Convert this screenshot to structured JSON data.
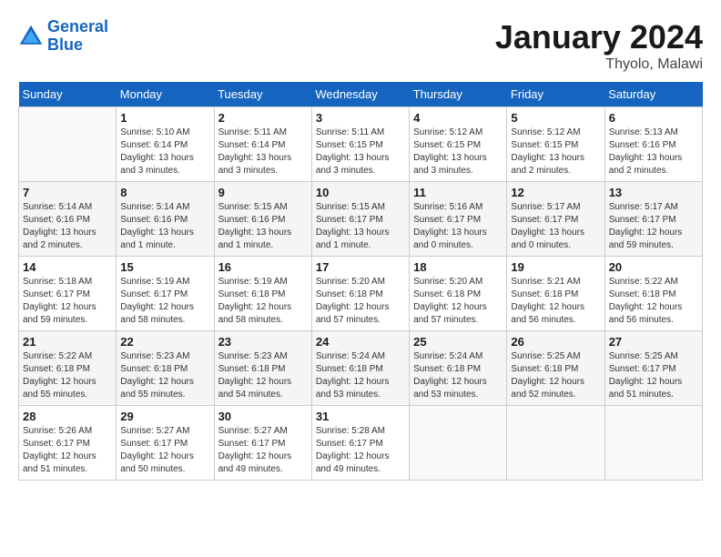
{
  "header": {
    "logo_line1": "General",
    "logo_line2": "Blue",
    "month_title": "January 2024",
    "subtitle": "Thyolo, Malawi"
  },
  "weekdays": [
    "Sunday",
    "Monday",
    "Tuesday",
    "Wednesday",
    "Thursday",
    "Friday",
    "Saturday"
  ],
  "weeks": [
    [
      {
        "day": "",
        "sunrise": "",
        "sunset": "",
        "daylight": ""
      },
      {
        "day": "1",
        "sunrise": "Sunrise: 5:10 AM",
        "sunset": "Sunset: 6:14 PM",
        "daylight": "Daylight: 13 hours and 3 minutes."
      },
      {
        "day": "2",
        "sunrise": "Sunrise: 5:11 AM",
        "sunset": "Sunset: 6:14 PM",
        "daylight": "Daylight: 13 hours and 3 minutes."
      },
      {
        "day": "3",
        "sunrise": "Sunrise: 5:11 AM",
        "sunset": "Sunset: 6:15 PM",
        "daylight": "Daylight: 13 hours and 3 minutes."
      },
      {
        "day": "4",
        "sunrise": "Sunrise: 5:12 AM",
        "sunset": "Sunset: 6:15 PM",
        "daylight": "Daylight: 13 hours and 3 minutes."
      },
      {
        "day": "5",
        "sunrise": "Sunrise: 5:12 AM",
        "sunset": "Sunset: 6:15 PM",
        "daylight": "Daylight: 13 hours and 2 minutes."
      },
      {
        "day": "6",
        "sunrise": "Sunrise: 5:13 AM",
        "sunset": "Sunset: 6:16 PM",
        "daylight": "Daylight: 13 hours and 2 minutes."
      }
    ],
    [
      {
        "day": "7",
        "sunrise": "Sunrise: 5:14 AM",
        "sunset": "Sunset: 6:16 PM",
        "daylight": "Daylight: 13 hours and 2 minutes."
      },
      {
        "day": "8",
        "sunrise": "Sunrise: 5:14 AM",
        "sunset": "Sunset: 6:16 PM",
        "daylight": "Daylight: 13 hours and 1 minute."
      },
      {
        "day": "9",
        "sunrise": "Sunrise: 5:15 AM",
        "sunset": "Sunset: 6:16 PM",
        "daylight": "Daylight: 13 hours and 1 minute."
      },
      {
        "day": "10",
        "sunrise": "Sunrise: 5:15 AM",
        "sunset": "Sunset: 6:17 PM",
        "daylight": "Daylight: 13 hours and 1 minute."
      },
      {
        "day": "11",
        "sunrise": "Sunrise: 5:16 AM",
        "sunset": "Sunset: 6:17 PM",
        "daylight": "Daylight: 13 hours and 0 minutes."
      },
      {
        "day": "12",
        "sunrise": "Sunrise: 5:17 AM",
        "sunset": "Sunset: 6:17 PM",
        "daylight": "Daylight: 13 hours and 0 minutes."
      },
      {
        "day": "13",
        "sunrise": "Sunrise: 5:17 AM",
        "sunset": "Sunset: 6:17 PM",
        "daylight": "Daylight: 12 hours and 59 minutes."
      }
    ],
    [
      {
        "day": "14",
        "sunrise": "Sunrise: 5:18 AM",
        "sunset": "Sunset: 6:17 PM",
        "daylight": "Daylight: 12 hours and 59 minutes."
      },
      {
        "day": "15",
        "sunrise": "Sunrise: 5:19 AM",
        "sunset": "Sunset: 6:17 PM",
        "daylight": "Daylight: 12 hours and 58 minutes."
      },
      {
        "day": "16",
        "sunrise": "Sunrise: 5:19 AM",
        "sunset": "Sunset: 6:18 PM",
        "daylight": "Daylight: 12 hours and 58 minutes."
      },
      {
        "day": "17",
        "sunrise": "Sunrise: 5:20 AM",
        "sunset": "Sunset: 6:18 PM",
        "daylight": "Daylight: 12 hours and 57 minutes."
      },
      {
        "day": "18",
        "sunrise": "Sunrise: 5:20 AM",
        "sunset": "Sunset: 6:18 PM",
        "daylight": "Daylight: 12 hours and 57 minutes."
      },
      {
        "day": "19",
        "sunrise": "Sunrise: 5:21 AM",
        "sunset": "Sunset: 6:18 PM",
        "daylight": "Daylight: 12 hours and 56 minutes."
      },
      {
        "day": "20",
        "sunrise": "Sunrise: 5:22 AM",
        "sunset": "Sunset: 6:18 PM",
        "daylight": "Daylight: 12 hours and 56 minutes."
      }
    ],
    [
      {
        "day": "21",
        "sunrise": "Sunrise: 5:22 AM",
        "sunset": "Sunset: 6:18 PM",
        "daylight": "Daylight: 12 hours and 55 minutes."
      },
      {
        "day": "22",
        "sunrise": "Sunrise: 5:23 AM",
        "sunset": "Sunset: 6:18 PM",
        "daylight": "Daylight: 12 hours and 55 minutes."
      },
      {
        "day": "23",
        "sunrise": "Sunrise: 5:23 AM",
        "sunset": "Sunset: 6:18 PM",
        "daylight": "Daylight: 12 hours and 54 minutes."
      },
      {
        "day": "24",
        "sunrise": "Sunrise: 5:24 AM",
        "sunset": "Sunset: 6:18 PM",
        "daylight": "Daylight: 12 hours and 53 minutes."
      },
      {
        "day": "25",
        "sunrise": "Sunrise: 5:24 AM",
        "sunset": "Sunset: 6:18 PM",
        "daylight": "Daylight: 12 hours and 53 minutes."
      },
      {
        "day": "26",
        "sunrise": "Sunrise: 5:25 AM",
        "sunset": "Sunset: 6:18 PM",
        "daylight": "Daylight: 12 hours and 52 minutes."
      },
      {
        "day": "27",
        "sunrise": "Sunrise: 5:25 AM",
        "sunset": "Sunset: 6:17 PM",
        "daylight": "Daylight: 12 hours and 51 minutes."
      }
    ],
    [
      {
        "day": "28",
        "sunrise": "Sunrise: 5:26 AM",
        "sunset": "Sunset: 6:17 PM",
        "daylight": "Daylight: 12 hours and 51 minutes."
      },
      {
        "day": "29",
        "sunrise": "Sunrise: 5:27 AM",
        "sunset": "Sunset: 6:17 PM",
        "daylight": "Daylight: 12 hours and 50 minutes."
      },
      {
        "day": "30",
        "sunrise": "Sunrise: 5:27 AM",
        "sunset": "Sunset: 6:17 PM",
        "daylight": "Daylight: 12 hours and 49 minutes."
      },
      {
        "day": "31",
        "sunrise": "Sunrise: 5:28 AM",
        "sunset": "Sunset: 6:17 PM",
        "daylight": "Daylight: 12 hours and 49 minutes."
      },
      {
        "day": "",
        "sunrise": "",
        "sunset": "",
        "daylight": ""
      },
      {
        "day": "",
        "sunrise": "",
        "sunset": "",
        "daylight": ""
      },
      {
        "day": "",
        "sunrise": "",
        "sunset": "",
        "daylight": ""
      }
    ]
  ]
}
